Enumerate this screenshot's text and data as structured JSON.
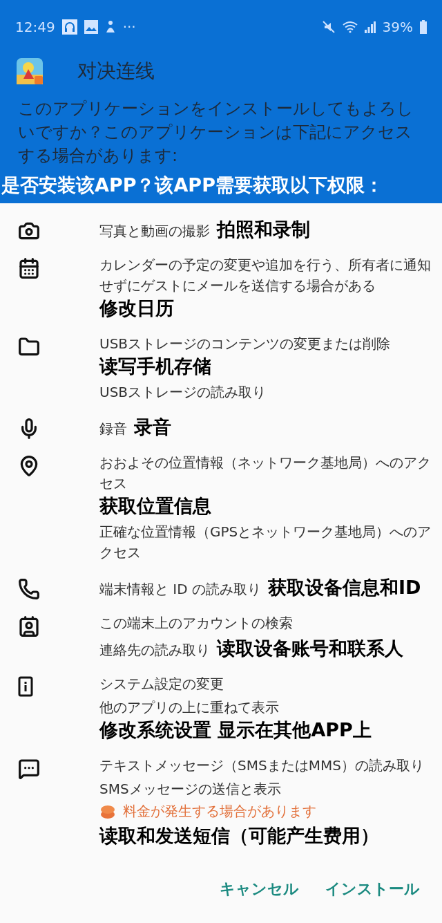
{
  "status_bar": {
    "time": "12:49",
    "more": "···",
    "battery": "39%"
  },
  "header": {
    "app_name": "对决连线",
    "description": "このアプリケーションをインストールしてもよろしいですか？このアプリケーションは下記にアクセスする場合があります:"
  },
  "banner": "是否安装该APP？该APP需要获取以下权限：",
  "permissions": [
    {
      "kind": "camera",
      "lines": [
        {
          "text": "写真と動画の撮影",
          "note": "拍照和录制"
        }
      ]
    },
    {
      "kind": "calendar",
      "lines": [
        {
          "text": "カレンダーの予定の変更や追加を行う、所有者に通知せずにゲストにメールを送信する場合がある",
          "note": "修改日历"
        }
      ]
    },
    {
      "kind": "storage",
      "lines": [
        {
          "text": "USBストレージのコンテンツの変更または削除",
          "note": "读写手机存储"
        },
        {
          "text": "USBストレージの読み取り"
        }
      ]
    },
    {
      "kind": "microphone",
      "lines": [
        {
          "text": "録音",
          "note": "录音"
        }
      ]
    },
    {
      "kind": "location",
      "lines": [
        {
          "text": "おおよその位置情報（ネットワーク基地局）へのアクセス",
          "note": "获取位置信息"
        },
        {
          "text": "正確な位置情報（GPSとネットワーク基地局）へのアクセス"
        }
      ]
    },
    {
      "kind": "phone",
      "lines": [
        {
          "text": "端末情報と ID の読み取り",
          "note": "获取设备信息和ID"
        }
      ]
    },
    {
      "kind": "contacts",
      "lines": [
        {
          "text": "この端末上のアカウントの検索"
        },
        {
          "text": "連絡先の読み取り",
          "note": "读取设备账号和联系人"
        }
      ]
    },
    {
      "kind": "settings",
      "lines": [
        {
          "text": "システム設定の変更"
        },
        {
          "text": "他のアプリの上に重ねて表示",
          "note": "修改系统设置 显示在其他APP上"
        }
      ]
    },
    {
      "kind": "sms",
      "lines": [
        {
          "text": "テキストメッセージ（SMSまたはMMS）の読み取り"
        },
        {
          "text": "SMSメッセージの送信と表示"
        }
      ],
      "warning": "料金が発生する場合があります",
      "note": "读取和发送短信（可能产生费用）"
    }
  ],
  "buttons": [
    {
      "label": "キャンセル"
    },
    {
      "label": "インストール"
    }
  ]
}
